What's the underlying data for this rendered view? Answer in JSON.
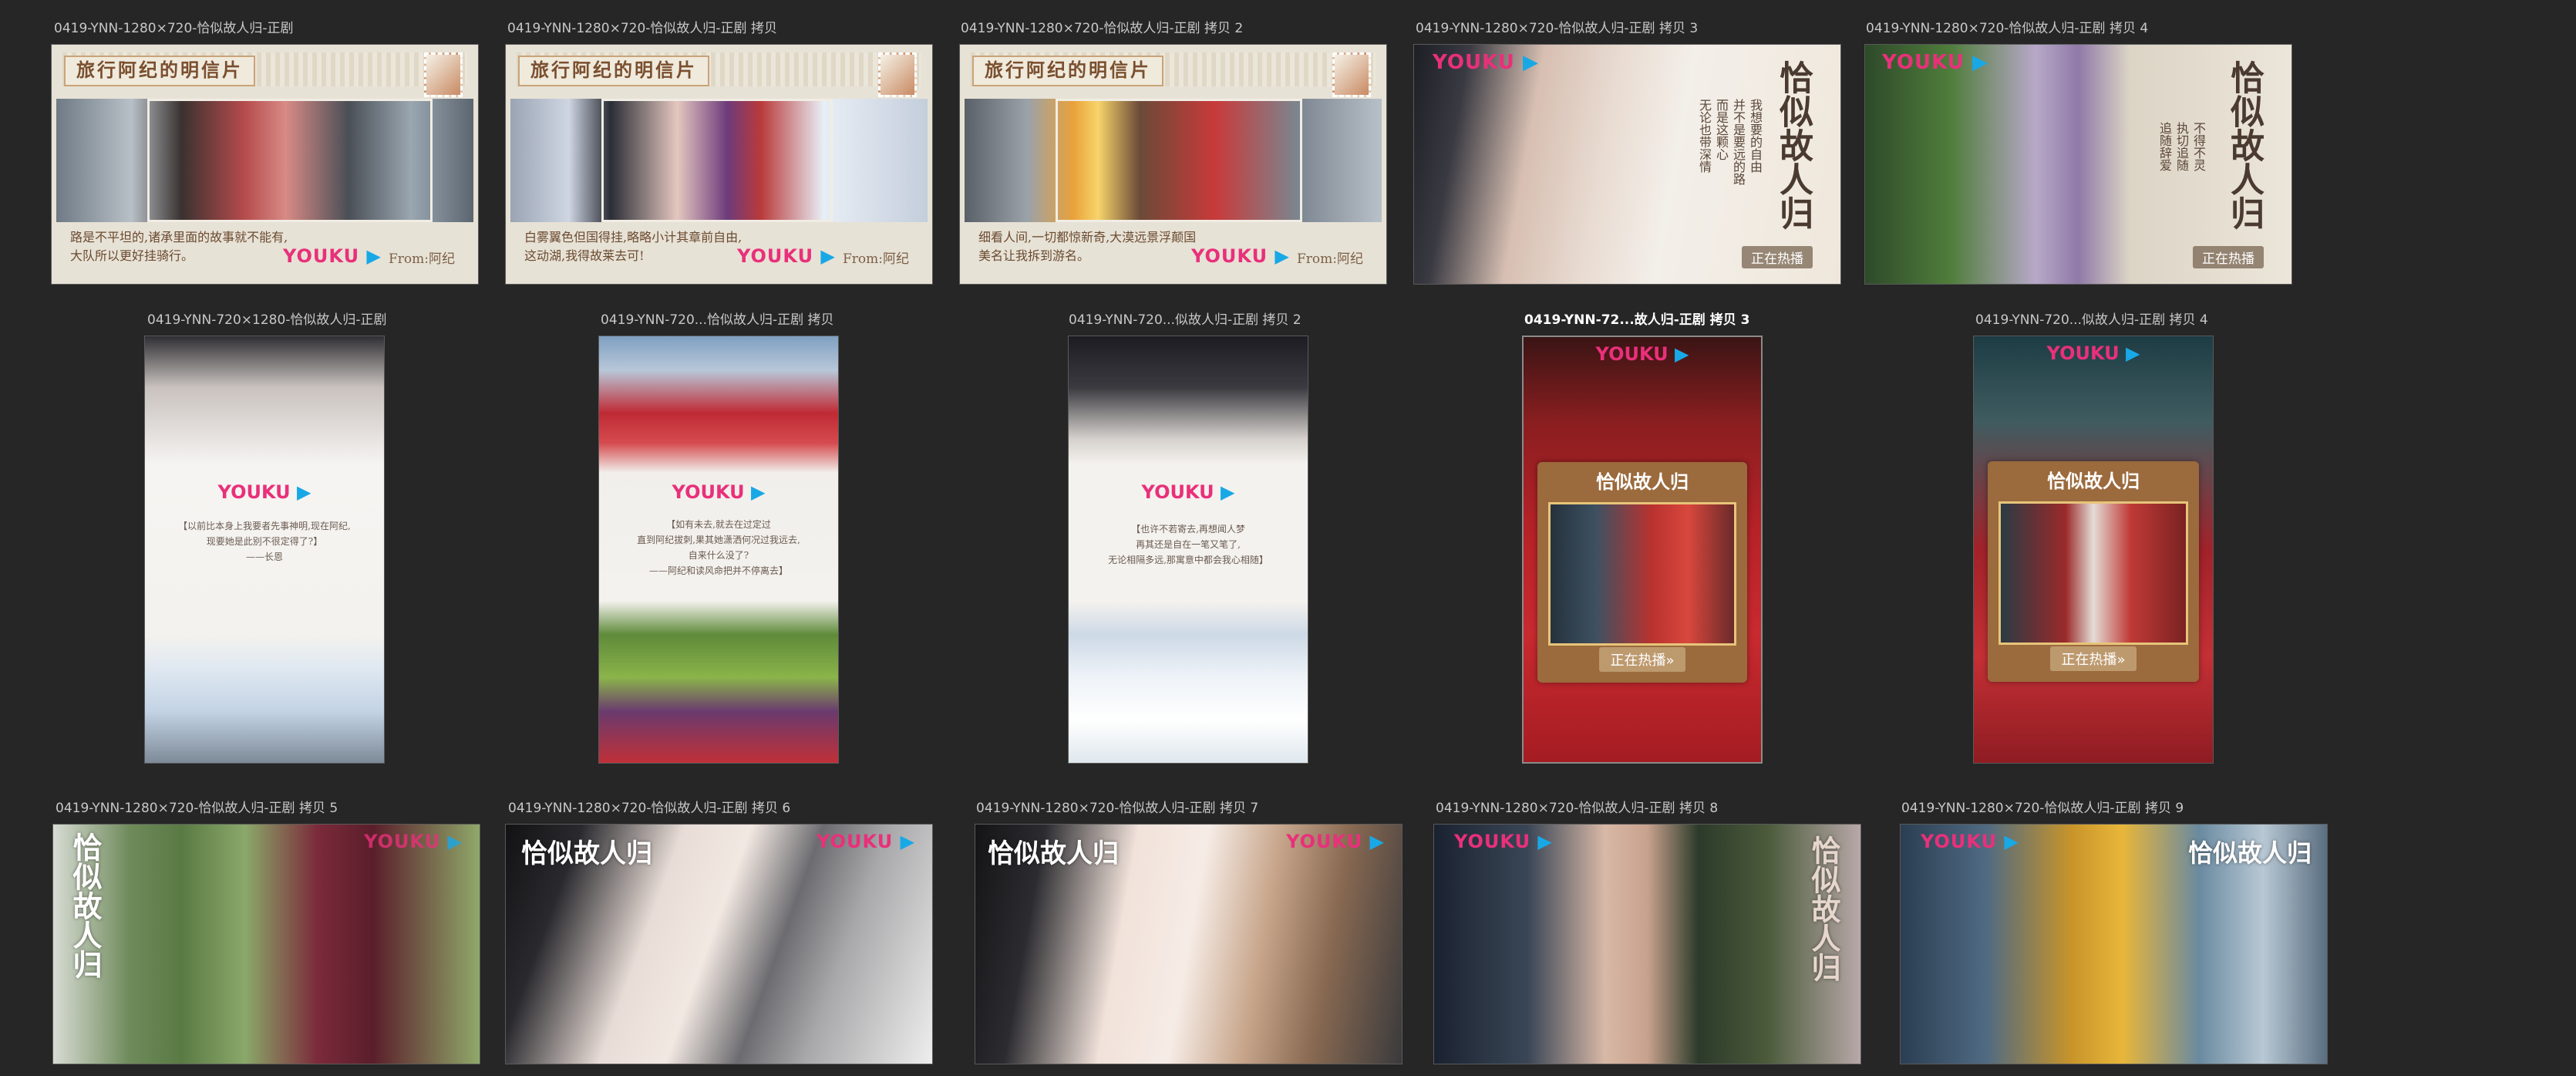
{
  "colors": {
    "background": "#262626",
    "label_text": "#c8c8c8",
    "youku_pink": "#e9307a",
    "youku_blue": "#18a8e6"
  },
  "assets": [
    {
      "label": "0419-YNN-1280×720-恰似故人归-正剧",
      "style": "postcard"
    },
    {
      "label": "0419-YNN-1280×720-恰似故人归-正剧 拷贝",
      "style": "postcard"
    },
    {
      "label": "0419-YNN-1280×720-恰似故人归-正剧 拷贝 2",
      "style": "postcard"
    },
    {
      "label": "0419-YNN-1280×720-恰似故人归-正剧 拷贝 3",
      "style": "promo-wide"
    },
    {
      "label": "0419-YNN-1280×720-恰似故人归-正剧 拷贝 4",
      "style": "promo-wide"
    },
    {
      "label": "0419-YNN-720×1280-恰似故人归-正剧",
      "style": "tall"
    },
    {
      "label": "0419-YNN-720...恰似故人归-正剧 拷贝",
      "style": "tall"
    },
    {
      "label": "0419-YNN-720...似故人归-正剧 拷贝 2",
      "style": "tall"
    },
    {
      "label": "0419-YNN-72...故人归-正剧 拷贝 3",
      "style": "framed",
      "selected": true
    },
    {
      "label": "0419-YNN-720...似故人归-正剧 拷贝 4",
      "style": "framed"
    },
    {
      "label": "0419-YNN-1280×720-恰似故人归-正剧 拷贝 5",
      "style": "still"
    },
    {
      "label": "0419-YNN-1280×720-恰似故人归-正剧 拷贝 6",
      "style": "still"
    },
    {
      "label": "0419-YNN-1280×720-恰似故人归-正剧 拷贝 7",
      "style": "still"
    },
    {
      "label": "0419-YNN-1280×720-恰似故人归-正剧 拷贝 8",
      "style": "still"
    },
    {
      "label": "0419-YNN-1280×720-恰似故人归-正剧 拷贝 9",
      "style": "still"
    }
  ],
  "postcard": {
    "title": "旅行阿纪的明信片",
    "texts": [
      "路是不平坦的,诸承里面的故事就不能有,\n大队所以更好挂骑行。",
      "白雾翼色但国得挂,略略小计其章前自由,\n这动湖,我得故莱去可!",
      "细看人间,一切都惊新奇,大漠远景浮颠国\n美名让我拆到游名。"
    ],
    "logo": "YOUKU",
    "from": "From:阿纪"
  },
  "promo": {
    "logo": "YOUKU",
    "title": "恰似故人归",
    "badge": "正在热播",
    "badge_arrow": "正在热播»",
    "vert_a": [
      "我想要的自由",
      "并不是要远的路",
      "而是这颗心",
      "无论也带深情"
    ],
    "vert_b": [
      "不得不灵",
      "执切追随",
      "追随辞爱"
    ]
  },
  "tall": {
    "logo": "YOUKU",
    "text_a": "【以前比本身上我要者先事神明,现在阿纪,\n现要她是此别不很定得了?】\n——长恩",
    "text_b": "【如有未去,就去在过定过\n直到阿纪拔刺,果其她潇洒何况过我远去,\n自来什么没了?\n——阿纪和读风命把并不停离去】",
    "text_c": "【也许不若寄去,再想闻人梦\n再其还是自在一笔又笔了,\n无论相隔多远,那寓意中都会我心相随】"
  }
}
